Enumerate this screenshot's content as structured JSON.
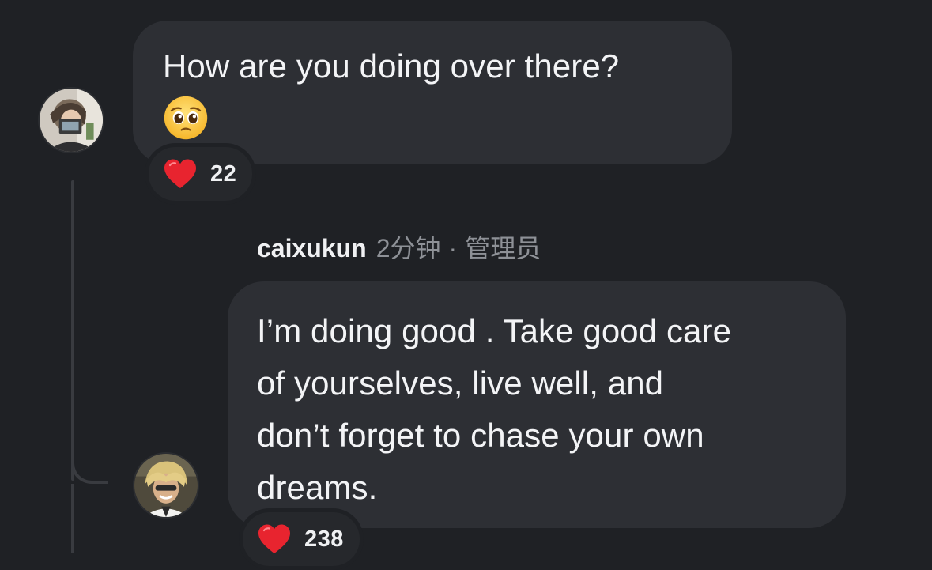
{
  "first_comment": {
    "text": "How are you doing over there?",
    "emoji": "pleading-face",
    "reaction": {
      "icon": "heart-icon",
      "count": "22"
    }
  },
  "reply": {
    "username": "caixukun",
    "time": "2分钟",
    "separator": "·",
    "role": "管理员",
    "text": "I’m doing good . Take good care\nof yourselves, live well, and\ndon’t forget to chase your own\ndreams.",
    "reaction": {
      "icon": "heart-icon",
      "count": "238"
    }
  },
  "colors": {
    "background": "#1f2125",
    "bubble": "#2d2f34",
    "heart": "#e8242f",
    "muted_text": "#8e9197"
  }
}
